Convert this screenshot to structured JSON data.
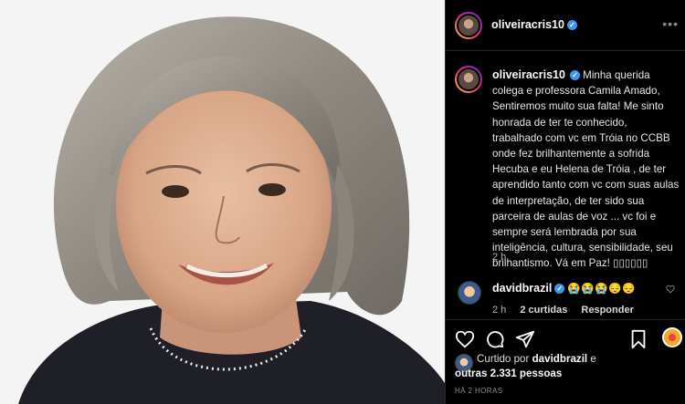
{
  "post": {
    "author": "oliveiracris10",
    "verified_mark": "✓"
  },
  "caption": {
    "author": "oliveiracris10",
    "verified_mark": "✓",
    "text": "Minha querida colega e professora Camila Amado, Sentiremos muito sua falta! Me sinto honrada de ter te conhecido, trabalhado com vc em Tróia no CCBB onde fez brilhantemente a sofrida Hecuba e eu Helena de Tróia , de ter aprendido tanto com vc com suas aulas de interpretação, de ter sido sua parceira de aulas de voz ... vc foi e sempre será lembrada por sua inteligência, cultura, sensibilidade, seu brilhantismo. Vá em Paz! ▯▯▯▯▯▯",
    "time": "2 h"
  },
  "reply": {
    "author": "davidbrazil",
    "verified_mark": "✓",
    "emojis": "😭😭😭😔😔",
    "time": "2 h",
    "likes": "2 curtidas",
    "reply_label": "Responder"
  },
  "likes": {
    "prefix": "Curtido por",
    "user": "davidbrazil",
    "conj": "e",
    "others": "outras 2.331 pessoas"
  },
  "timestamp": "HÁ 2 HORAS",
  "icons": [
    "more-icon",
    "heart-icon",
    "comment-icon",
    "share-icon",
    "bookmark-icon"
  ],
  "colors": {
    "verified": "#3897f0",
    "background": "#000000",
    "muted": "#8e8e8e"
  }
}
